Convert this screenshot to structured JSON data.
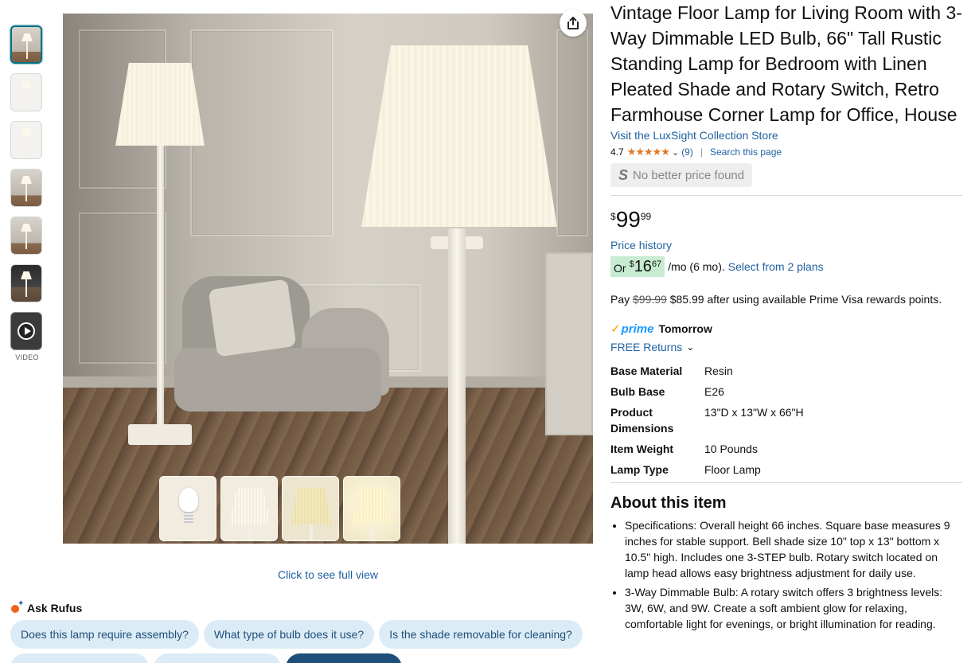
{
  "gallery": {
    "thumbnails": [
      {
        "label": "image-1",
        "style": "room"
      },
      {
        "label": "image-2",
        "style": "grid"
      },
      {
        "label": "image-3",
        "style": "grid"
      },
      {
        "label": "image-4",
        "style": "room"
      },
      {
        "label": "image-5",
        "style": "room"
      },
      {
        "label": "image-6",
        "style": "dark"
      }
    ],
    "video_label": "VIDEO",
    "full_view": "Click to see full view"
  },
  "rufus": {
    "title": "Ask Rufus",
    "chips": [
      "Does this lamp require assembly?",
      "What type of bulb does it use?",
      "Is the shade removable for cleaning?"
    ]
  },
  "product": {
    "title": "Vintage Floor Lamp for Living Room with 3-Way Dimmable LED Bulb, 66\" Tall Rustic Standing Lamp for Bedroom with Linen Pleated Shade and Rotary Switch, Retro Farmhouse Corner Lamp for Office, House",
    "store_link": "Visit the LuxSight Collection Store",
    "rating": "4.7",
    "stars": "★★★★★",
    "review_count": "(9)",
    "search_page": "Search this page",
    "no_better_price": "No better price found",
    "price": {
      "currency": "$",
      "whole": "99",
      "fraction": "99"
    },
    "price_history": "Price history",
    "monthly": {
      "or": "Or",
      "currency": "$",
      "whole": "16",
      "fraction": "67",
      "rest": "/mo (6 mo).",
      "plans_link": "Select from 2 plans"
    },
    "rewards": {
      "prefix": "Pay",
      "old_price": "$99.99",
      "text": "$85.99 after using available Prime Visa rewards points."
    },
    "prime": {
      "word": "prime",
      "delivery": "Tomorrow"
    },
    "returns": "FREE Returns",
    "specs": [
      {
        "label": "Base Material",
        "value": "Resin"
      },
      {
        "label": "Bulb Base",
        "value": "E26"
      },
      {
        "label": "Product Dimensions",
        "value": "13\"D x 13\"W x 66\"H"
      },
      {
        "label": "Item Weight",
        "value": "10 Pounds"
      },
      {
        "label": "Lamp Type",
        "value": "Floor Lamp"
      }
    ],
    "about_title": "About this item",
    "bullets": [
      "Specifications: Overall height 66 inches. Square base measures 9 inches for stable support. Bell shade size 10\" top x 13\" bottom x 10.5\" high. Includes one 3-STEP bulb. Rotary switch located on lamp head allows easy brightness adjustment for daily use.",
      "3-Way Dimmable Bulb: A rotary switch offers 3 brightness levels: 3W, 6W, and 9W. Create a soft ambient glow for relaxing, comfortable light for evenings, or bright illumination for reading."
    ]
  },
  "colors": {
    "link": "#2162a1",
    "star": "#de7921",
    "prime_blue": "#1a98ff",
    "monthly_badge": "#c7ecd1",
    "chip_bg": "#dcecf6"
  }
}
